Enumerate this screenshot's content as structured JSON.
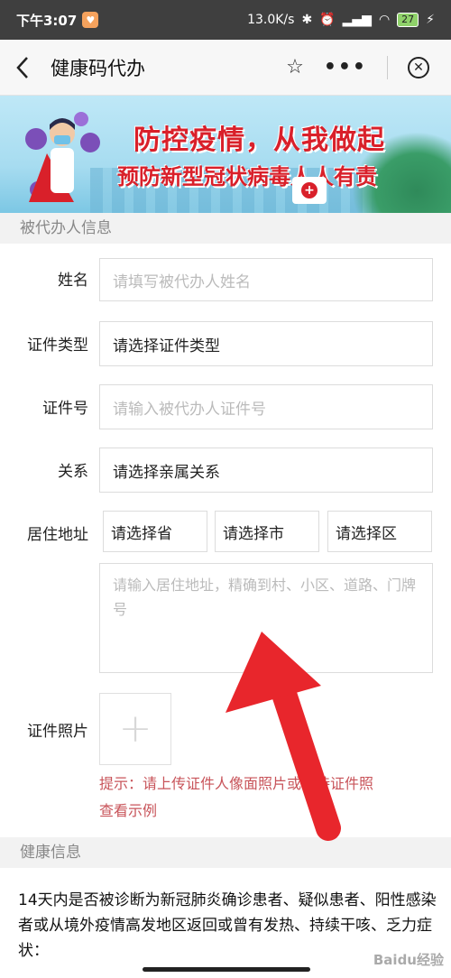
{
  "status_bar": {
    "time": "下午3:07",
    "network_speed": "13.0K/s",
    "battery": "27"
  },
  "nav": {
    "title": "健康码代办"
  },
  "banner": {
    "line1": "防控疫情，从我做起",
    "line2": "预防新型冠状病毒人人有责"
  },
  "section_agent": {
    "title": "被代办人信息"
  },
  "form": {
    "name": {
      "label": "姓名",
      "placeholder": "请填写被代办人姓名"
    },
    "id_type": {
      "label": "证件类型",
      "value": "请选择证件类型"
    },
    "id_number": {
      "label": "证件号",
      "placeholder": "请输入被代办人证件号"
    },
    "relation": {
      "label": "关系",
      "value": "请选择亲属关系"
    },
    "address": {
      "label": "居住地址",
      "province": "请选择省",
      "city": "请选择市",
      "district": "请选择区",
      "detail_placeholder": "请输入居住地址，精确到村、小区、道路、门牌号"
    },
    "photo": {
      "label": "证件照片",
      "hint": "提示：请上传证件人像面照片或手持证件照",
      "example_link": "查看示例"
    }
  },
  "section_health": {
    "title": "健康信息",
    "question": "14天内是否被诊断为新冠肺炎确诊患者、疑似患者、阳性感染者或从境外疫情高发地区返回或曾有发热、持续干咳、乏力症状："
  },
  "watermark": "Baidu经验",
  "colors": {
    "accent_red": "#d9202a",
    "hint_red": "#c8545a",
    "arrow_red": "#e8262c"
  }
}
